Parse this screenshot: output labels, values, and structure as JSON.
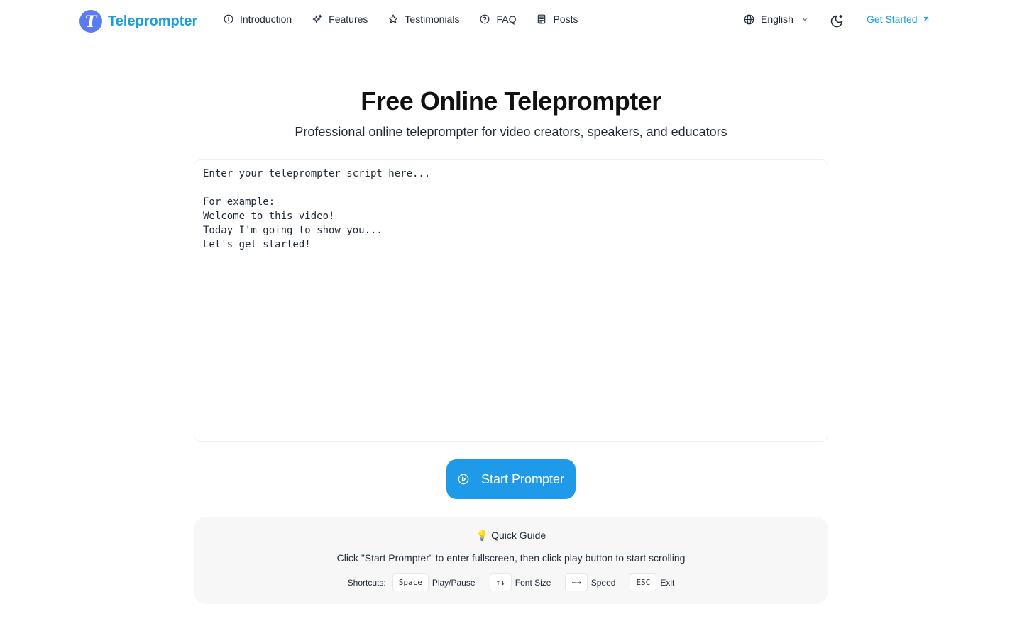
{
  "header": {
    "logo_letter": "T",
    "brand": "Teleprompter",
    "nav": [
      {
        "label": "Introduction",
        "icon": "info-circle-icon"
      },
      {
        "label": "Features",
        "icon": "sparkles-icon"
      },
      {
        "label": "Testimonials",
        "icon": "star-icon"
      },
      {
        "label": "FAQ",
        "icon": "help-circle-icon"
      },
      {
        "label": "Posts",
        "icon": "document-icon"
      }
    ],
    "language": "English",
    "get_started": "Get Started"
  },
  "hero": {
    "title": "Free Online Teleprompter",
    "subtitle": "Professional online teleprompter for video creators, speakers, and educators"
  },
  "editor": {
    "placeholder": "Enter your teleprompter script here...\n\nFor example:\nWelcome to this video!\nToday I'm going to show you...\nLet's get started!"
  },
  "start_button": "Start Prompter",
  "guide": {
    "title": "💡 Quick Guide",
    "description": "Click \"Start Prompter\" to enter fullscreen, then click play button to start scrolling",
    "shortcuts_label": "Shortcuts:",
    "shortcuts": [
      {
        "key": "Space",
        "action": "Play/Pause"
      },
      {
        "key": "↑↓",
        "action": "Font Size"
      },
      {
        "key": "←→",
        "action": "Speed"
      },
      {
        "key": "ESC",
        "action": "Exit"
      }
    ]
  },
  "colors": {
    "brand": "#1a9ee0",
    "logo_badge": "#5b7cf0",
    "button": "#1e9ae8",
    "guide_bg": "#f7f7f7"
  }
}
